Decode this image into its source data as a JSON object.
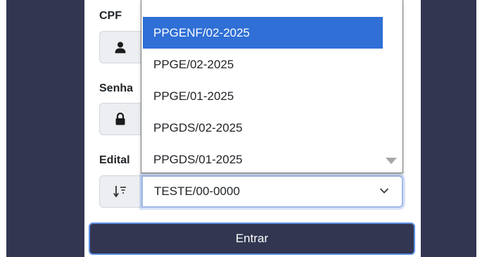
{
  "form": {
    "cpf_label": "CPF",
    "senha_label": "Senha",
    "edital_label": "Edital",
    "edital_selected": "TESTE/00-0000",
    "submit_label": "Entrar"
  },
  "dropdown": {
    "options": [
      "PPGENF/02-2025",
      "PPGE/02-2025",
      "PPGE/01-2025",
      "PPGDS/02-2025",
      "PPGDS/01-2025"
    ],
    "highlighted_index": 0
  },
  "icons": {
    "cpf": "user-icon",
    "senha": "lock-icon",
    "edital": "sort-icon",
    "select": "chevron-down-icon"
  },
  "colors": {
    "primary_dark": "#323651",
    "highlight": "#2f6fd6",
    "focus_border": "#9fb7ea"
  }
}
